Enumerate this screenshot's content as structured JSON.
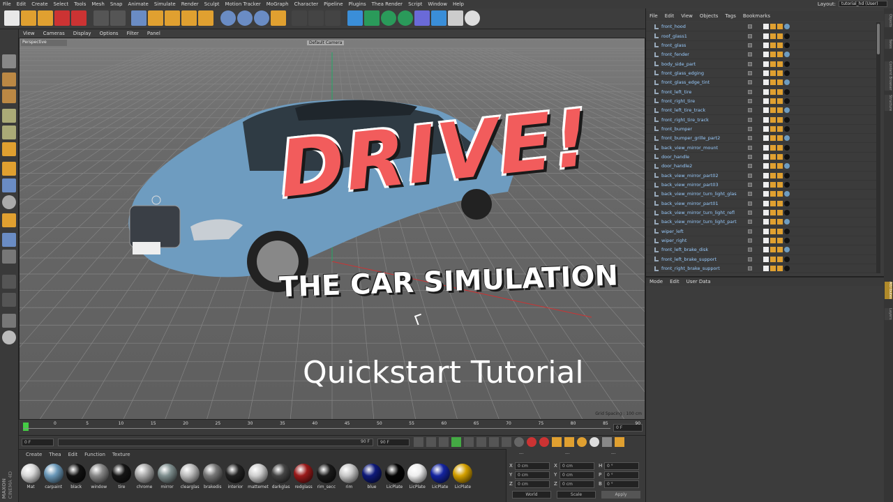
{
  "menu": [
    "File",
    "Edit",
    "Create",
    "Select",
    "Tools",
    "Mesh",
    "Snap",
    "Animate",
    "Simulate",
    "Render",
    "Sculpt",
    "Motion Tracker",
    "MoGraph",
    "Character",
    "Pipeline",
    "Plugins",
    "Thea Render",
    "Script",
    "Window",
    "Help"
  ],
  "layout": {
    "label": "Layout:",
    "value": "tutorial_hd (User)"
  },
  "viewport_menu": [
    "View",
    "Cameras",
    "Display",
    "Options",
    "Filter",
    "Panel"
  ],
  "viewport": {
    "name": "Perspective",
    "camera": "Default Camera",
    "grid_spacing": "Grid Spacing : 100 cm",
    "title": "DRIVE!",
    "subtitle": "THE CAR SIMULATION",
    "caption": "Quickstart Tutorial"
  },
  "timeline": {
    "ticks": [
      "0",
      "5",
      "10",
      "15",
      "20",
      "25",
      "30",
      "35",
      "40",
      "45",
      "50",
      "55",
      "60",
      "65",
      "70",
      "75",
      "80",
      "85",
      "90"
    ],
    "frame_field": "0 F",
    "start_field": "0 F",
    "range_end": "90 F",
    "end_field": "90 F"
  },
  "material_menu": [
    "Create",
    "Thea",
    "Edit",
    "Function",
    "Texture"
  ],
  "materials": [
    {
      "label": "Mat",
      "color": "#d8d8d8"
    },
    {
      "label": "carpaint",
      "color": "#6a98b8"
    },
    {
      "label": "black",
      "color": "#111111"
    },
    {
      "label": "window",
      "color": "#888888"
    },
    {
      "label": "tire",
      "color": "#151515"
    },
    {
      "label": "chrome",
      "color": "#aaaaaa"
    },
    {
      "label": "mirror",
      "color": "#7f8f8f"
    },
    {
      "label": "clearglas",
      "color": "#bbbbbb"
    },
    {
      "label": "brakedis",
      "color": "#777777"
    },
    {
      "label": "interior",
      "color": "#222222"
    },
    {
      "label": "mattemet",
      "color": "#cfcfcf"
    },
    {
      "label": "darkglas",
      "color": "#444444"
    },
    {
      "label": "redglass",
      "color": "#9a1a1a"
    },
    {
      "label": "rim_secc",
      "color": "#1a1a1a"
    },
    {
      "label": "rim",
      "color": "#c8c8c8"
    },
    {
      "label": "blue",
      "color": "#0e1a7a"
    },
    {
      "label": "LicPlate",
      "color": "#050505"
    },
    {
      "label": "LicPlate",
      "color": "#eeeeee"
    },
    {
      "label": "LicPlate",
      "color": "#1424a0"
    },
    {
      "label": "LicPlate",
      "color": "#d4a000"
    }
  ],
  "coords": {
    "header": [
      "---",
      "---",
      "---"
    ],
    "rows": [
      {
        "a": "X",
        "av": "0 cm",
        "b": "X",
        "bv": "0 cm",
        "c": "H",
        "cv": "0 °"
      },
      {
        "a": "Y",
        "av": "0 cm",
        "b": "Y",
        "bv": "0 cm",
        "c": "P",
        "cv": "0 °"
      },
      {
        "a": "Z",
        "av": "0 cm",
        "b": "Z",
        "bv": "0 cm",
        "c": "B",
        "cv": "0 °"
      }
    ],
    "mode": "World",
    "scale": "Scale",
    "apply": "Apply"
  },
  "objects_menu": [
    "File",
    "Edit",
    "View",
    "Objects",
    "Tags",
    "Bookmarks"
  ],
  "objects": [
    "front_hood",
    "roof_glass1",
    "front_glass",
    "front_fender",
    "body_side_part",
    "front_glass_edging",
    "front_glass_edge_tint",
    "front_left_tire",
    "front_right_tire",
    "front_left_tire_track",
    "front_right_tire_track",
    "front_bumper",
    "front_bumper_grille_part2",
    "back_view_mirror_mount",
    "door_handle",
    "door_handle2",
    "back_view_mirror_part02",
    "back_view_mirror_part03",
    "back_view_mirror_turn_light_glas",
    "back_view_mirror_part01",
    "back_view_mirror_turn_light_refl",
    "back_view_mirror_turn_light_part",
    "wiper_left",
    "wiper_right",
    "front_left_brake_disk",
    "front_left_brake_support",
    "front_right_brake_support"
  ],
  "attributes_menu": [
    "Mode",
    "Edit",
    "User Data"
  ],
  "side_tabs": [
    "Objects",
    "Takes",
    "Content Browser",
    "Structure",
    "Attributes",
    "Layers"
  ],
  "brand": [
    "MAXON",
    "CINEMA 4D"
  ],
  "colors": {
    "accent": "#f25c5c",
    "car": "#6e9cc0",
    "title_outline": "#1a1a1a"
  }
}
